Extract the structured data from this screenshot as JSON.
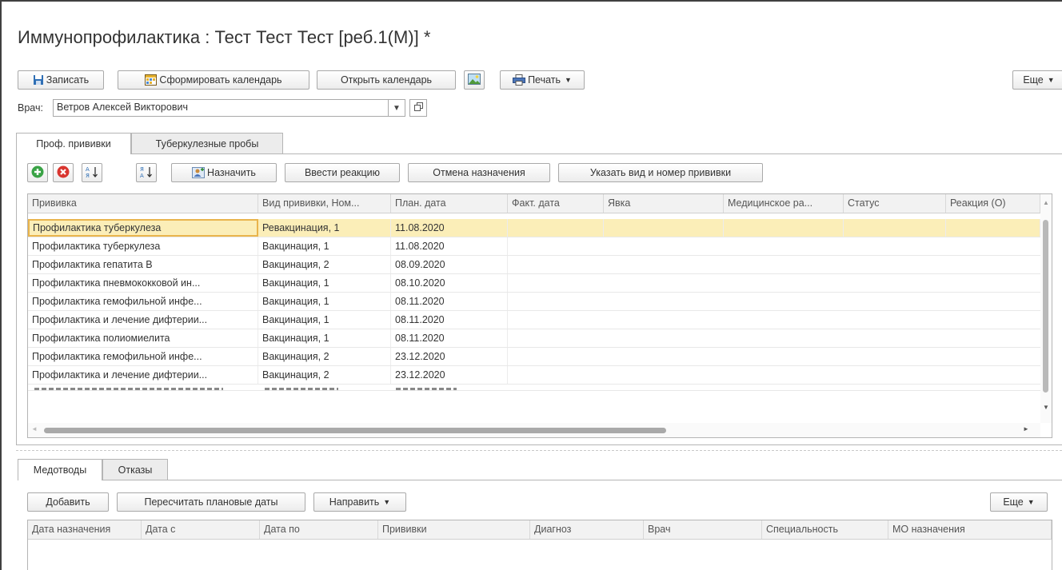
{
  "window": {
    "title": "Иммунопрофилактика : Тест Тест Тест [реб.1(М)] *"
  },
  "toolbar": {
    "save": "Записать",
    "form_calendar": "Сформировать календарь",
    "open_calendar": "Открыть календарь",
    "print": "Печать",
    "more": "Еще"
  },
  "doctor": {
    "label": "Врач:",
    "value": "Ветров Алексей Викторович"
  },
  "tabs": [
    {
      "label": "Проф. прививки"
    },
    {
      "label": "Туберкулезные пробы"
    }
  ],
  "vacc_toolbar": {
    "assign": "Назначить",
    "enter_reaction": "Ввести реакцию",
    "cancel_assign": "Отмена назначения",
    "specify": "Указать вид и номер прививки"
  },
  "vacc_table": {
    "columns": [
      "Прививка",
      "Вид прививки, Ном...",
      "План. дата",
      "Факт. дата",
      "Явка",
      "Медицинское ра...",
      "Статус",
      "Реакция (О)"
    ],
    "rows": [
      [
        "Профилактика туберкулеза",
        "Ревакцинация, 1",
        "11.08.2020"
      ],
      [
        "Профилактика туберкулеза",
        "Вакцинация, 1",
        "11.08.2020"
      ],
      [
        "Профилактика гепатита В",
        "Вакцинация, 2",
        "08.09.2020"
      ],
      [
        "Профилактика пневмококковой ин...",
        "Вакцинация, 1",
        "08.10.2020"
      ],
      [
        "Профилактика гемофильной инфе...",
        "Вакцинация, 1",
        "08.11.2020"
      ],
      [
        "Профилактика и лечение дифтерии...",
        "Вакцинация, 1",
        "08.11.2020"
      ],
      [
        "Профилактика полиомиелита",
        "Вакцинация, 1",
        "08.11.2020"
      ],
      [
        "Профилактика гемофильной инфе...",
        "Вакцинация, 2",
        "23.12.2020"
      ],
      [
        "Профилактика и лечение дифтерии...",
        "Вакцинация, 2",
        "23.12.2020"
      ]
    ]
  },
  "bottom_tabs": [
    {
      "label": "Медотводы"
    },
    {
      "label": "Отказы"
    }
  ],
  "bottom_toolbar": {
    "add": "Добавить",
    "recalc": "Пересчитать плановые даты",
    "send": "Направить",
    "more": "Еще"
  },
  "medotvod_table": {
    "columns": [
      "Дата назначения",
      "Дата с",
      "Дата по",
      "Прививки",
      "Диагноз",
      "Врач",
      "Специальность",
      "МО назначения"
    ]
  },
  "colors": {
    "selected_row": "#fbeeb8",
    "focus_border": "#e9b44c",
    "add_icon": "#3aa346",
    "delete_icon": "#d9352f"
  }
}
